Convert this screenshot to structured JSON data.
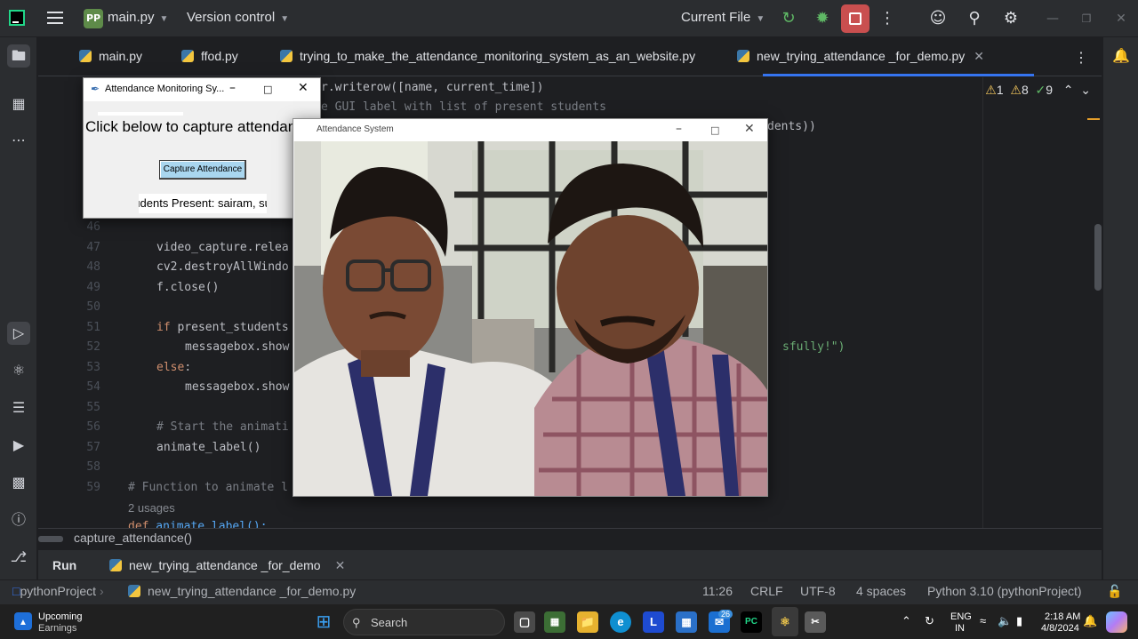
{
  "titlebar": {
    "project_badge": "PP",
    "project_name": "main.py",
    "vcs": "Version control",
    "run_config": "Current File"
  },
  "tabs": [
    {
      "label": "main.py"
    },
    {
      "label": "ffod.py"
    },
    {
      "label": "trying_to_make_the_attendance_monitoring_system_as_an_website.py"
    },
    {
      "label": "new_trying_attendance _for_demo.py",
      "active": true
    }
  ],
  "inspections": {
    "warnings": "1",
    "weak_warnings": "8",
    "ok": "9"
  },
  "code_lines": {
    "l_top1": "r.writerow([name, current_time])",
    "l_top2": "e GUI label with list of present students",
    "l_top3": "dents))",
    "l46": "46",
    "l47": "47",
    "l48": "48",
    "l49": "49",
    "l50": "50",
    "l51": "51",
    "l52": "52",
    "l53": "53",
    "l54": "54",
    "l55": "55",
    "l56": "56",
    "l57": "57",
    "l58": "58",
    "l59": "59",
    "c47": "video_capture.relea",
    "c48": "cv2.destroyAllWindo",
    "c49": "f.close()",
    "c51_kw": "if",
    "c51": " present_students",
    "c52": "messagebox.show",
    "c52_tail": "sfully!\")",
    "c53_kw": "else",
    "c53": ":",
    "c54": "messagebox.show",
    "c56": "# Start the animati",
    "c57": "animate_label()",
    "c59": "# Function to animate l",
    "usages": "2 usages",
    "c60_kw": "def",
    "c60": " animate_label():"
  },
  "breadcrumb": "capture_attendance()",
  "run_panel": {
    "title": "Run",
    "config": "new_trying_attendance _for_demo"
  },
  "statusbar": {
    "project": "pythonProject",
    "file": "new_trying_attendance _for_demo.py",
    "position": "11:26",
    "line_sep": "CRLF",
    "encoding": "UTF-8",
    "indent": "4 spaces",
    "interpreter": "Python 3.10 (pythonProject)"
  },
  "tk_window": {
    "title": "Attendance Monitoring Sy...",
    "heading": "Click below to capture attendance",
    "button": "Capture Attendance",
    "status": "Students Present: sairam, surr"
  },
  "camera_window": {
    "title": "Attendance System"
  },
  "taskbar": {
    "widget_title": "Upcoming",
    "widget_sub": "Earnings",
    "search": "Search",
    "badge": "26",
    "lang": "ENG",
    "region": "IN",
    "time": "2:18 AM",
    "date": "4/8/2024"
  }
}
